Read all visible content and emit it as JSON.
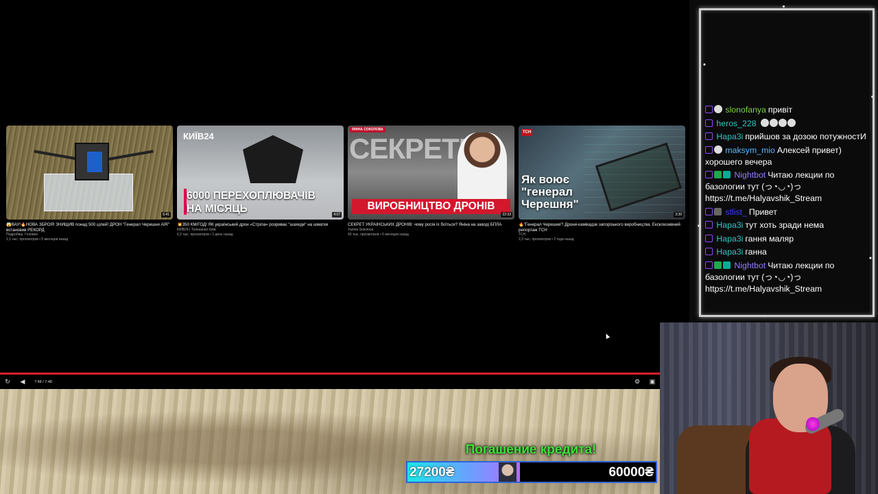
{
  "endscreen": {
    "cards": [
      {
        "title": "😱ВАУ!🔥НОВА ЗБРОЯ! ЗНИЩИВ понад 500 цілей! ДРОН \"Генерал Черешня AIR\" встановив РЕКОРД",
        "channel": "Подробиці. Головне",
        "stats": "1,1 тыс. просмотров • 5 месяцев назад",
        "duration": "5:41"
      },
      {
        "title": "💥350 КМ/ГОД! ЯК український дрон «Стріла» розриває \"шахеди\" на шматки",
        "channel": "КИЇВ24 | Телеканал Київ",
        "stats": "6,2 тыс. просмотров • 1 день назад",
        "duration": "4:07",
        "logo": "КИЇВ24",
        "caption_line1": "6000 ПЕРЕХОПЛЮВАЧІВ",
        "caption_line2": "НА МІСЯЦЬ"
      },
      {
        "title": "СЕКРЕТ УКРАЇНСЬКИХ ДРОНІВ: чому росія їх боїться? Яніна на заводі БПЛА",
        "channel": "Yanina Sokolova",
        "stats": "43 тыс. просмотров • 6 месяцев назад",
        "duration": "22:33",
        "badge": "ЯНІНА СОКОЛОВА",
        "big_word": "СЕКРЕТЕ",
        "caption": "ВИРОБНИЦТВО ДРОНІВ"
      },
      {
        "title": "🔥\"Генерал Черешня\"! Дрони-камікадзе запорізького виробництва. Ексклюзивний репортаж ТСН",
        "channel": "ТСН",
        "stats": "2,3 тыс. просмотров • 2 года назад",
        "duration": "3:39",
        "logo": "ТСН",
        "caption_line1": "Як воює",
        "caption_line2": "\"генерал",
        "caption_line3": "Черешня\""
      }
    ]
  },
  "player": {
    "time": "7:48 / 7:48",
    "replay_icon": "replay-icon",
    "volume_icon": "volume-icon",
    "settings_icon": "gear-icon",
    "fullscreen_icon": "fullscreen-icon",
    "progress_color": "#e01f2a",
    "progress": 1.0
  },
  "chat": {
    "messages": [
      {
        "user": "slonofanya",
        "text": "привіт",
        "color": "#7bd148"
      },
      {
        "user": "heros_228",
        "text": "",
        "color": "#2ec4c4"
      },
      {
        "user": "Нара3і",
        "text": "прийшов за дозою потужностИ",
        "color": "#2ec4c4"
      },
      {
        "user": "maksym_mio",
        "text": "Алексей привет)",
        "color": "#5fb4ff"
      },
      {
        "user": "хорошего вечера",
        "text": "",
        "color": "#ffffff"
      },
      {
        "user": "Nightbot",
        "text": "Читаю лекции по базологии тут (っ◔◡◔)っ https://t.me/Halyavshik_Stream",
        "color": "#8e7dff"
      },
      {
        "user": "stlist_",
        "text": "Привет",
        "color": "#3a3aff"
      },
      {
        "user": "Нара3і",
        "text": "тут хоть зради нема",
        "color": "#2ec4c4"
      },
      {
        "user": "Нара3і",
        "text": "гання маляр",
        "color": "#2ec4c4"
      },
      {
        "user": "Нара3і",
        "text": "ганна",
        "color": "#2ec4c4"
      },
      {
        "user": "Nightbot",
        "text": "Читаю лекции по базологии тут (っ◔◡◔)っ https://t.me/Halyavshik_Stream",
        "color": "#8e7dff"
      }
    ]
  },
  "goal": {
    "title": "Погашение кредита!",
    "current": "27200₴",
    "target": "60000₴",
    "fraction": 0.4533,
    "title_color": "#3de23a"
  }
}
